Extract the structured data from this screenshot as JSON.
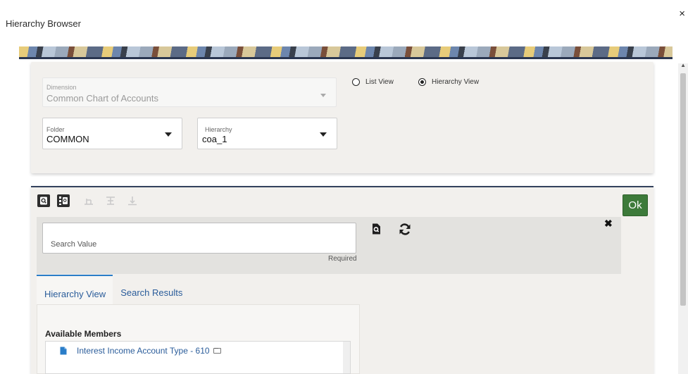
{
  "dialog": {
    "title": "Hierarchy Browser",
    "close_label": "×"
  },
  "top_panel": {
    "dimension": {
      "label": "Dimension",
      "value": "Common Chart of Accounts"
    },
    "folder": {
      "label": "Folder",
      "value": "COMMON"
    },
    "hierarchy": {
      "label": "Hierarchy",
      "value": "coa_1"
    },
    "view_options": [
      {
        "label": "List View",
        "selected": false
      },
      {
        "label": "Hierarchy View",
        "selected": true
      }
    ]
  },
  "toolbar": {
    "buttons": [
      {
        "icon": "search-icon",
        "enabled": true
      },
      {
        "icon": "hierarchy-search-icon",
        "enabled": true
      },
      {
        "icon": "expand-tree-icon",
        "enabled": false
      },
      {
        "icon": "collapse-tree-icon",
        "enabled": false
      },
      {
        "icon": "move-down-icon",
        "enabled": false
      }
    ],
    "ok_label": "Ok"
  },
  "search": {
    "placeholder": "Search Value",
    "required_label": "Required",
    "close_label": "✖"
  },
  "tabs": [
    {
      "label": "Hierarchy View",
      "active": true
    },
    {
      "label": "Search Results",
      "active": false
    }
  ],
  "members": {
    "title": "Available Members",
    "items": [
      {
        "label": "Interest Income Account Type - 610"
      }
    ]
  },
  "colors": {
    "ok_button": "#3d7a3a",
    "link": "#2a5c9a",
    "active_tab_border": "#2a7dc8",
    "panel_border": "#32415c"
  }
}
